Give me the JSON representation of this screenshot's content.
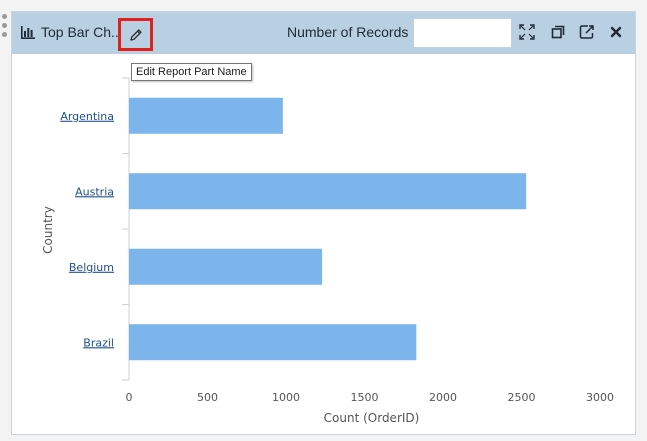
{
  "panel": {
    "title": "Top Bar Ch..",
    "records_label": "Number of Records",
    "records_value": "",
    "tooltip": "Edit Report Part Name",
    "icons": {
      "chart_type": "bar-chart-icon",
      "edit": "pencil-icon",
      "expand": "expand-icon",
      "copy": "copy-icon",
      "export": "export-icon",
      "close": "close-icon"
    }
  },
  "colors": {
    "header_bg": "#b9d0e2",
    "bar": "#7cb4ec",
    "highlight": "#e0201f"
  },
  "chart_data": {
    "type": "bar",
    "orientation": "horizontal",
    "categories": [
      "Argentina",
      "Austria",
      "Belgium",
      "Brazil"
    ],
    "values": [
      980,
      2530,
      1230,
      1830
    ],
    "xlabel": "Count (OrderID)",
    "ylabel": "Country",
    "xlim": [
      0,
      3000
    ],
    "xticks": [
      "0",
      "500",
      "1000",
      "1500",
      "2000",
      "2500",
      "3000"
    ],
    "grid": false,
    "legend": "none"
  }
}
